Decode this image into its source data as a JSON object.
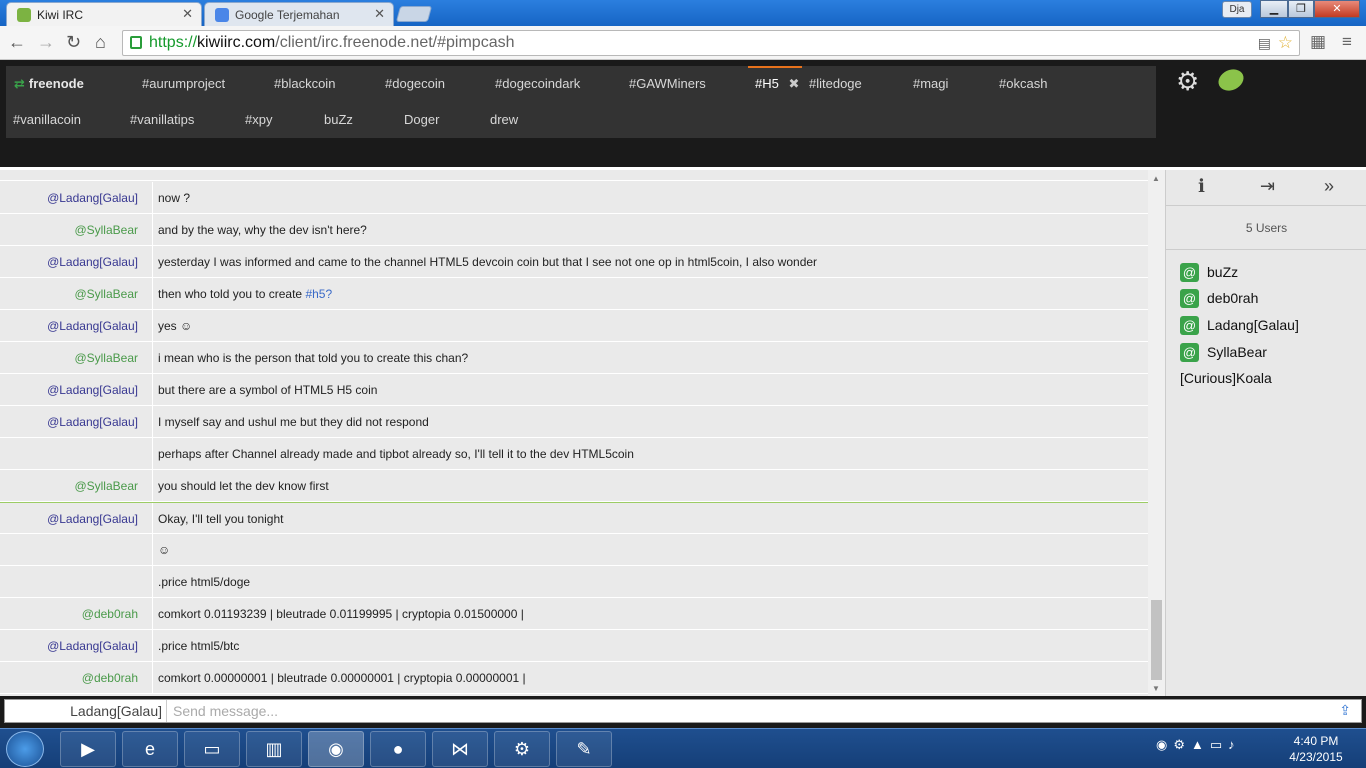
{
  "browser": {
    "tabs": [
      {
        "title": "Kiwi IRC",
        "active": true
      },
      {
        "title": "Google Terjemahan",
        "active": false
      }
    ],
    "user_button": "Dja",
    "url": {
      "scheme": "https://",
      "host": "kiwiirc.com",
      "path": "/client/irc.freenode.net/#pimpcash"
    }
  },
  "irc": {
    "channels_row1": [
      "freenode",
      "#aurumproject",
      "#blackcoin",
      "#dogecoin",
      "#dogecoindark",
      "#GAWMiners",
      "#H5",
      "#litedoge",
      "#magi",
      "#okcash"
    ],
    "channels_row2": [
      "#vanillacoin",
      "#vanillatips",
      "#xpy",
      "buZz",
      "Doger",
      "drew"
    ],
    "active_channel": "#H5",
    "close_glyph": "✖",
    "messages": [
      {
        "nick": "@Ladang[Galau]",
        "text": "now ?"
      },
      {
        "nick": "@SyllaBear",
        "text": "and by the way, why the dev isn't here?"
      },
      {
        "nick": "@Ladang[Galau]",
        "text": "yesterday I was informed and came to the channel HTML5 devcoin coin but that I see not one op in html5coin, I also wonder"
      },
      {
        "nick": "@SyllaBear",
        "text": "then who told you to create ",
        "link": "#h5?"
      },
      {
        "nick": "@Ladang[Galau]",
        "text": "yes ☺"
      },
      {
        "nick": "@SyllaBear",
        "text": "i mean who is the person that told you to create this chan?"
      },
      {
        "nick": "@Ladang[Galau]",
        "text": "but there are a symbol of HTML5 H5 coin"
      },
      {
        "nick": "@Ladang[Galau]",
        "text": "I myself say and ushul me but they did not respond"
      },
      {
        "nick": "",
        "text": "perhaps after Channel already made and tipbot already so, I'll tell it to the dev HTML5coin"
      },
      {
        "nick": "@SyllaBear",
        "text": "you should let the dev know first"
      },
      {
        "nick": "@Ladang[Galau]",
        "text": "Okay, I'll tell you tonight"
      },
      {
        "nick": "",
        "text": "☺"
      },
      {
        "nick": "",
        "text": ".price html5/doge"
      },
      {
        "nick": "@deb0rah",
        "text": "comkort 0.01193239 | bleutrade 0.01199995 | cryptopia 0.01500000 |"
      },
      {
        "nick": "@Ladang[Galau]",
        "text": ".price html5/btc"
      },
      {
        "nick": "@deb0rah",
        "text": "comkort 0.00000001 | bleutrade 0.00000001 | cryptopia 0.00000001 |"
      }
    ],
    "sidebar": {
      "user_count": "5 Users",
      "users": [
        {
          "name": "buZz",
          "op": true
        },
        {
          "name": "deb0rah",
          "op": true
        },
        {
          "name": "Ladang[Galau]",
          "op": true
        },
        {
          "name": "SyllaBear",
          "op": true
        },
        {
          "name": "[Curious]Koala",
          "op": false
        }
      ],
      "op_glyph": "@"
    },
    "input": {
      "nick": "Ladang[Galau]",
      "placeholder": "Send message..."
    }
  },
  "taskbar": {
    "clock_time": "4:40 PM",
    "clock_date": "4/23/2015"
  },
  "colors": {
    "op_badge": "#3aa34a",
    "active_tab_underline": "#e8721c",
    "nick_ladang": "#373791",
    "nick_other": "#4a9a4a"
  }
}
